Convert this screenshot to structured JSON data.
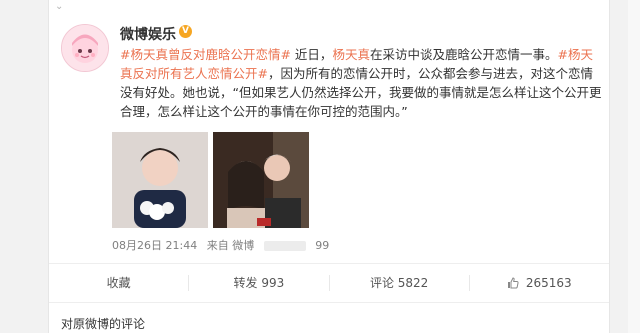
{
  "post": {
    "username": "微博娱乐",
    "verified_badge": "V",
    "content": [
      {
        "type": "tag",
        "text": "#杨天真曾反对鹿晗公开恋情#"
      },
      {
        "type": "text",
        "text": " 近日，"
      },
      {
        "type": "link",
        "text": "杨天真"
      },
      {
        "type": "text",
        "text": "在采访中谈及鹿晗公开恋情一事。"
      },
      {
        "type": "tag",
        "text": "#杨天真反对所有艺人恋情公开#"
      },
      {
        "type": "text",
        "text": "，因为所有的恋情公开时，公众都会参与进去，对这个恋情没有好处。她也说，“但如果艺人仍然选择公开，我要做的事情就是怎么样让这个公开更合理，怎么样让这个公开的事情在你可控的范围内。”"
      }
    ],
    "timestamp": "08月26日 21:44",
    "source_label": "来自 微博",
    "source_suffix": "99"
  },
  "actions": [
    {
      "label": "收藏"
    },
    {
      "label": "转发 993"
    },
    {
      "label": "评论 5822"
    },
    {
      "label": "265163"
    }
  ],
  "comment_section_title": "对原微博的评论",
  "colors": {
    "accent": "#eb7350",
    "badge": "#f6a623"
  }
}
